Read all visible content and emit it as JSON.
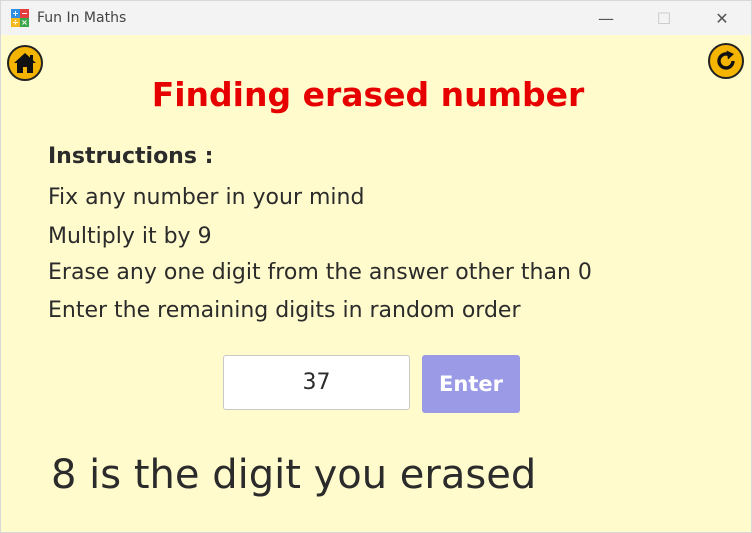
{
  "window": {
    "title": "Fun In Maths",
    "icon_glyphs": [
      "+",
      "−",
      "÷",
      "×"
    ],
    "controls": {
      "minimize": "—",
      "maximize": "☐",
      "close": "✕"
    }
  },
  "nav": {
    "home_icon": "home-icon",
    "refresh_icon": "refresh-icon",
    "accent": "#f4b400"
  },
  "main": {
    "heading": "Finding erased number",
    "heading_color": "#e60000",
    "instructions_title": "Instructions :",
    "instructions": [
      "Fix any number in your mind",
      "Multiply it by 9",
      "Erase any one digit from the answer other than 0",
      "Enter the remaining digits in random order"
    ],
    "input_value": "37",
    "enter_label": "Enter",
    "enter_color": "#9a9ae6",
    "result": "8 is the digit you erased"
  }
}
